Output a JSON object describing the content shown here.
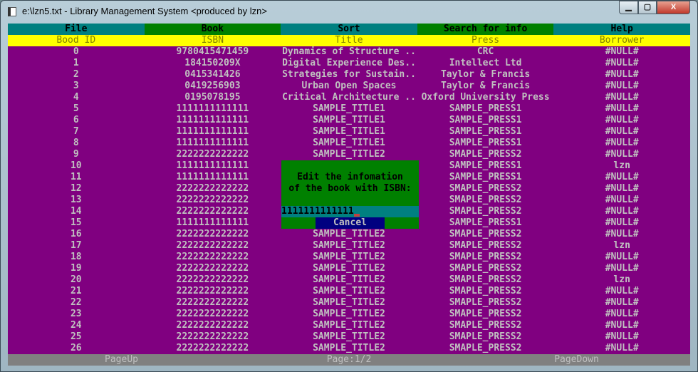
{
  "window": {
    "title": "e:\\lzn5.txt - Library Management System <produced by lzn>",
    "minimize": "▁",
    "maximize": "▢",
    "close": "X"
  },
  "menu": [
    {
      "label": "File"
    },
    {
      "label": "Book"
    },
    {
      "label": "Sort"
    },
    {
      "label": "Search for info"
    },
    {
      "label": "Help"
    }
  ],
  "columns": [
    "Bood ID",
    "ISBN",
    "Title",
    "Press",
    "Borrower"
  ],
  "rows": [
    [
      "0",
      "9780415471459",
      "Dynamics of Structure ..",
      "CRC",
      "#NULL#"
    ],
    [
      "1",
      "184150209X",
      "Digital Experience Des..",
      "Intellect Ltd",
      "#NULL#"
    ],
    [
      "2",
      "0415341426",
      "Strategies for Sustain..",
      "Taylor & Francis",
      "#NULL#"
    ],
    [
      "3",
      "0419256903",
      "Urban Open Spaces",
      "Taylor & Francis",
      "#NULL#"
    ],
    [
      "4",
      "0195078195",
      "Critical Architecture ..",
      "Oxford University Press",
      "#NULL#"
    ],
    [
      "5",
      "1111111111111",
      "SAMPLE_TITLE1",
      "SAMPLE_PRESS1",
      "#NULL#"
    ],
    [
      "6",
      "1111111111111",
      "SAMPLE_TITLE1",
      "SAMPLE_PRESS1",
      "#NULL#"
    ],
    [
      "7",
      "1111111111111",
      "SAMPLE_TITLE1",
      "SAMPLE_PRESS1",
      "#NULL#"
    ],
    [
      "8",
      "1111111111111",
      "SAMPLE_TITLE1",
      "SAMPLE_PRESS1",
      "#NULL#"
    ],
    [
      "9",
      "2222222222222",
      "SAMPLE_TITLE2",
      "SMAPLE_PRESS2",
      "#NULL#"
    ],
    [
      "10",
      "1111111111111",
      "",
      "SAMPLE_PRESS1",
      "lzn"
    ],
    [
      "11",
      "1111111111111",
      "",
      "SAMPLE_PRESS1",
      "#NULL#"
    ],
    [
      "12",
      "2222222222222",
      "",
      "SMAPLE_PRESS2",
      "#NULL#"
    ],
    [
      "13",
      "2222222222222",
      "",
      "SMAPLE_PRESS2",
      "#NULL#"
    ],
    [
      "14",
      "2222222222222",
      "",
      "SMAPLE_PRESS2",
      "#NULL#"
    ],
    [
      "15",
      "1111111111111",
      "",
      "SAMPLE_PRESS1",
      "#NULL#"
    ],
    [
      "16",
      "2222222222222",
      "SAMPLE_TITLE2",
      "SMAPLE_PRESS2",
      "#NULL#"
    ],
    [
      "17",
      "2222222222222",
      "SAMPLE_TITLE2",
      "SMAPLE_PRESS2",
      "lzn"
    ],
    [
      "18",
      "2222222222222",
      "SAMPLE_TITLE2",
      "SMAPLE_PRESS2",
      "#NULL#"
    ],
    [
      "19",
      "2222222222222",
      "SAMPLE_TITLE2",
      "SMAPLE_PRESS2",
      "#NULL#"
    ],
    [
      "20",
      "2222222222222",
      "SAMPLE_TITLE2",
      "SMAPLE_PRESS2",
      "lzn"
    ],
    [
      "21",
      "2222222222222",
      "SAMPLE_TITLE2",
      "SMAPLE_PRESS2",
      "#NULL#"
    ],
    [
      "22",
      "2222222222222",
      "SAMPLE_TITLE2",
      "SMAPLE_PRESS2",
      "#NULL#"
    ],
    [
      "23",
      "2222222222222",
      "SAMPLE_TITLE2",
      "SMAPLE_PRESS2",
      "#NULL#"
    ],
    [
      "24",
      "2222222222222",
      "SAMPLE_TITLE2",
      "SMAPLE_PRESS2",
      "#NULL#"
    ],
    [
      "25",
      "2222222222222",
      "SAMPLE_TITLE2",
      "SMAPLE_PRESS2",
      "#NULL#"
    ],
    [
      "26",
      "2222222222222",
      "SAMPLE_TITLE2",
      "SMAPLE_PRESS2",
      "#NULL#"
    ]
  ],
  "footer": {
    "page_up": "PageUp",
    "page": "Page:1/2",
    "page_down": "PageDown"
  },
  "dialog": {
    "line1": "Edit the infomation",
    "line2": "of the book with ISBN:",
    "input_value": "1111111111111",
    "cancel": "Cancel"
  },
  "colors": {
    "background": "#800080",
    "menu_teal": "#008080",
    "menu_green": "#008000",
    "header": "#ffff00",
    "footer": "#808080",
    "cancel": "#000080"
  }
}
